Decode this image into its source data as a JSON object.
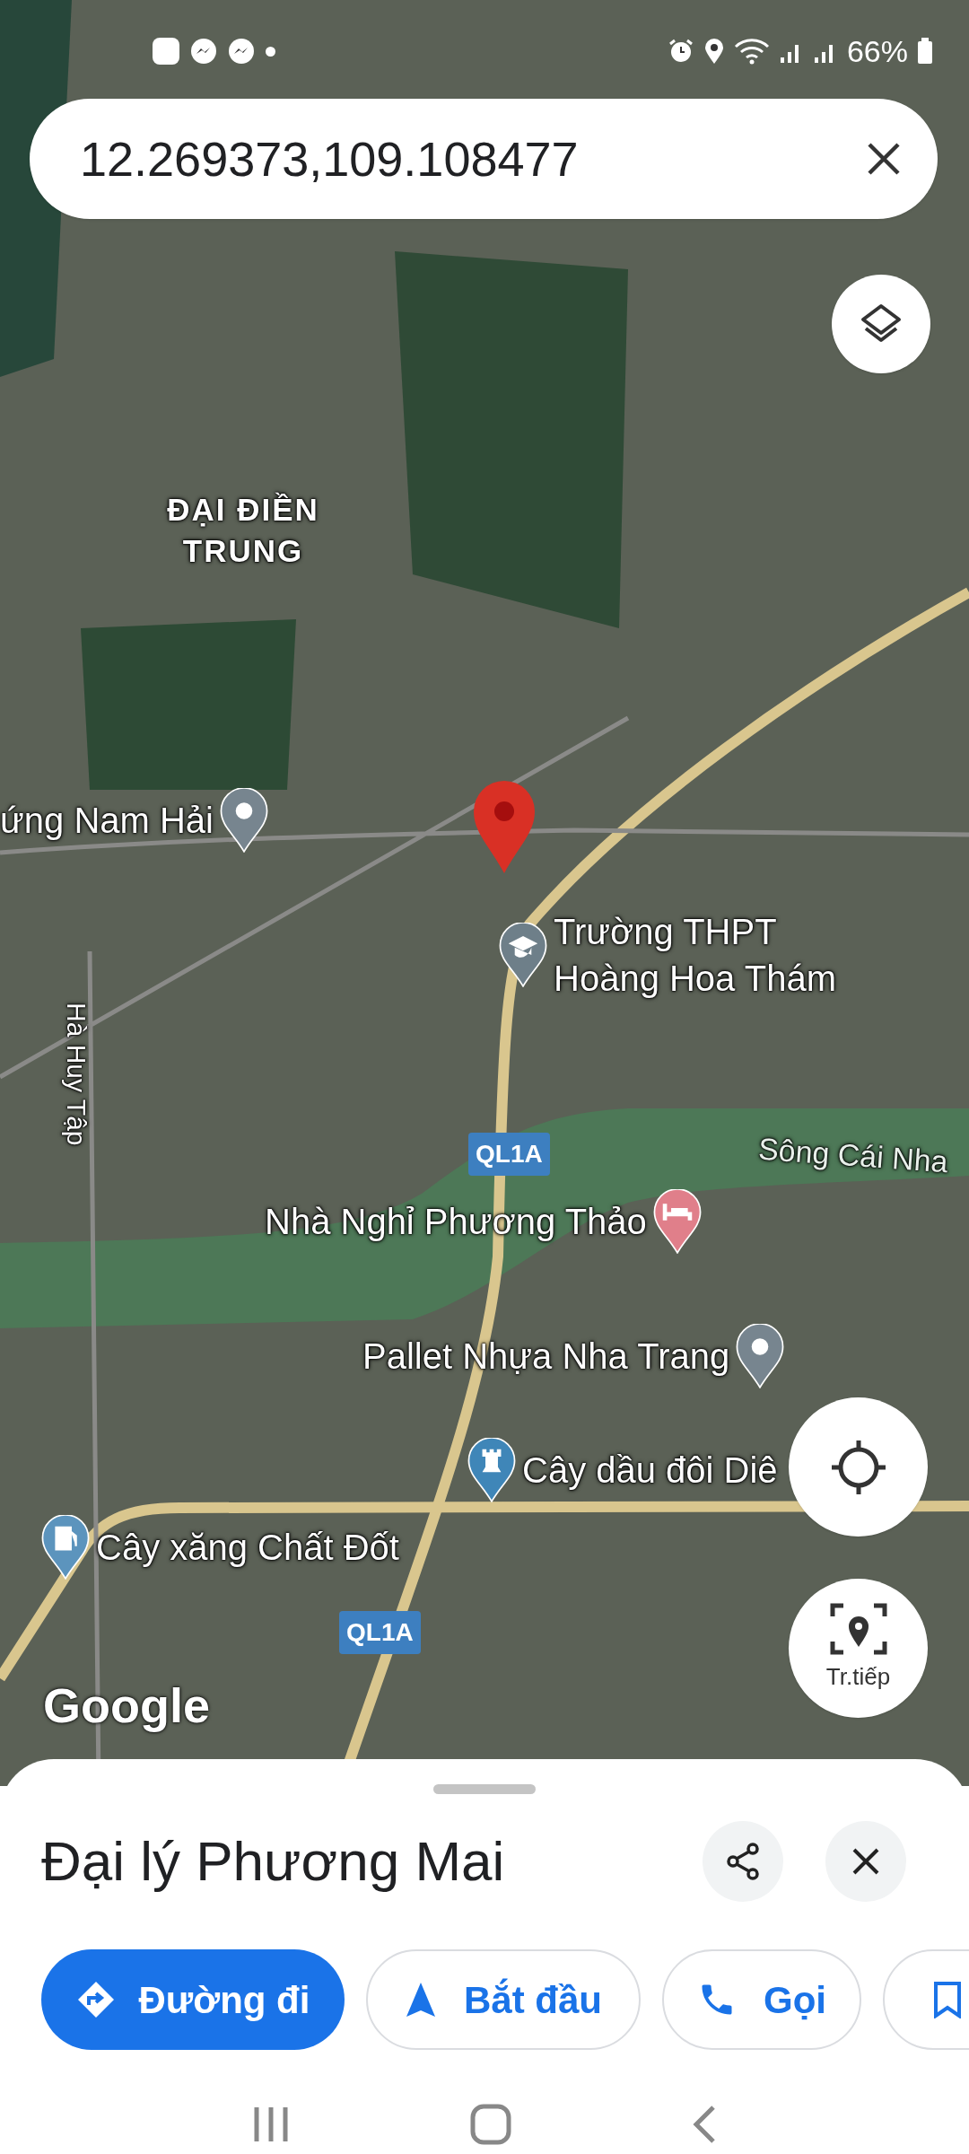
{
  "status_bar": {
    "battery": "66%"
  },
  "search": {
    "value": "12.269373,109.108477"
  },
  "map": {
    "labels": [
      {
        "kind": "area",
        "text": "ĐẠI ĐIỀN TRUNG"
      },
      {
        "kind": "poi",
        "text": "ứng Nam Hải"
      },
      {
        "kind": "school",
        "text": "Trường THPT\nHoàng Hoa Thám"
      },
      {
        "kind": "road",
        "text": "Hà Huy Tập"
      },
      {
        "kind": "shield",
        "text": "QL1A"
      },
      {
        "kind": "water",
        "text": "Sông Cái Nha"
      },
      {
        "kind": "hotel",
        "text": "Nhà Nghỉ Phương Thảo"
      },
      {
        "kind": "poi",
        "text": "Pallet Nhựa Nha Trang"
      },
      {
        "kind": "landmark",
        "text": "Cây dầu đôi Diê"
      },
      {
        "kind": "gas",
        "text": "Cây xăng Chất Đốt"
      },
      {
        "kind": "shield",
        "text": "QL1A"
      }
    ],
    "attribution": "Google",
    "street_view_label": "Tr.tiếp"
  },
  "place": {
    "title": "Đại lý Phương Mai",
    "actions": [
      {
        "kind": "directions",
        "label": "Đường đi"
      },
      {
        "kind": "start",
        "label": "Bắt đầu"
      },
      {
        "kind": "call",
        "label": "Gọi"
      },
      {
        "kind": "save"
      }
    ]
  }
}
